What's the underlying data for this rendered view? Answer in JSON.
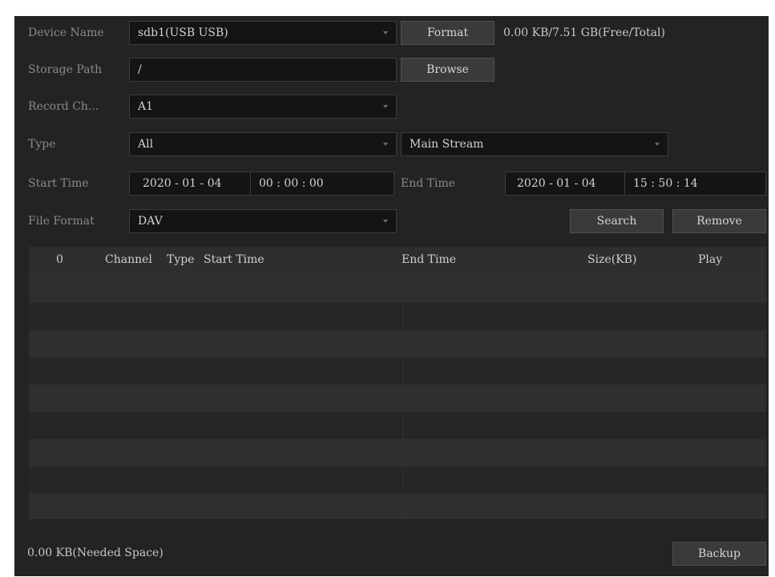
{
  "form": {
    "device_name": {
      "label": "Device Name",
      "value": "sdb1(USB USB)"
    },
    "format_button": "Format",
    "capacity": "0.00 KB/7.51 GB(Free/Total)",
    "storage_path": {
      "label": "Storage Path",
      "value": "/"
    },
    "browse_button": "Browse",
    "record_channel": {
      "label": "Record Ch...",
      "value": "A1"
    },
    "type": {
      "label": "Type",
      "value": "All"
    },
    "stream": {
      "value": "Main Stream"
    },
    "start_time": {
      "label": "Start Time",
      "date": "2020 - 01 - 04",
      "time": "00 : 00 : 00"
    },
    "end_time": {
      "label": "End Time",
      "date": "2020 - 01 - 04",
      "time": "15 : 50 : 14"
    },
    "file_format": {
      "label": "File Format",
      "value": "DAV"
    },
    "search_button": "Search",
    "remove_button": "Remove"
  },
  "table": {
    "columns": [
      "0",
      "Channel",
      "Type",
      "Start Time",
      "End Time",
      "Size(KB)",
      "Play"
    ],
    "rows": []
  },
  "footer": {
    "needed_space": "0.00 KB(Needed Space)",
    "backup_button": "Backup"
  },
  "colors": {
    "panel_bg": "#232323",
    "field_bg": "#141414",
    "button_bg": "#3a3a3a",
    "label_text": "#8a8a8a",
    "value_text": "#d2d2d2"
  },
  "icons": {
    "dropdown": "caret-down-icon"
  }
}
